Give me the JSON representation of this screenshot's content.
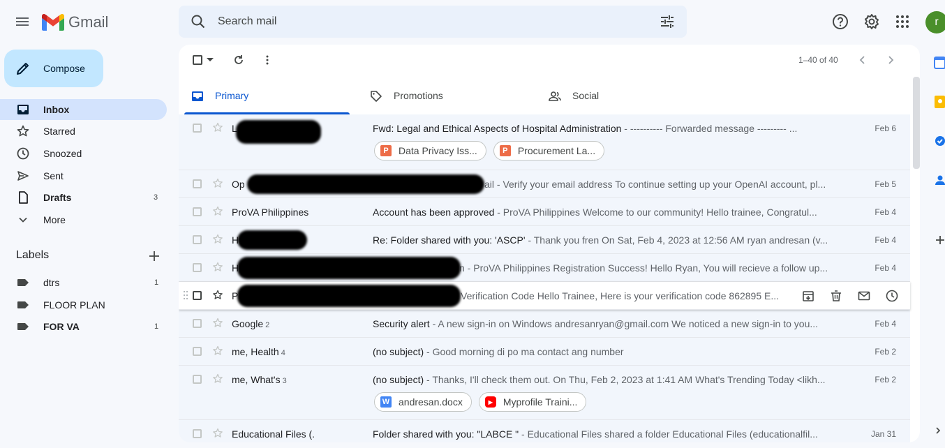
{
  "app": {
    "name": "Gmail"
  },
  "search": {
    "placeholder": "Search mail"
  },
  "avatar": {
    "initial": "r",
    "color": "#4a8f2a"
  },
  "compose": {
    "label": "Compose"
  },
  "nav": [
    {
      "label": "Inbox",
      "count": ""
    },
    {
      "label": "Starred",
      "count": ""
    },
    {
      "label": "Snoozed",
      "count": ""
    },
    {
      "label": "Sent",
      "count": ""
    },
    {
      "label": "Drafts",
      "count": "3"
    },
    {
      "label": "More",
      "count": ""
    }
  ],
  "labels": {
    "heading": "Labels",
    "items": [
      {
        "name": "dtrs",
        "count": "1"
      },
      {
        "name": "FLOOR PLAN",
        "count": ""
      },
      {
        "name": "FOR VA",
        "count": "1"
      }
    ]
  },
  "pager": {
    "text": "1–40 of 40"
  },
  "tabs": [
    {
      "label": "Primary",
      "active": true
    },
    {
      "label": "Promotions",
      "active": false
    },
    {
      "label": "Social",
      "active": false
    }
  ],
  "emails": [
    {
      "sender": "L",
      "count": "",
      "subject": "Fwd: Legal and Ethical Aspects of Hospital Administration",
      "snippet": " - ---------- Forwarded message --------- ...",
      "date": "Feb 6",
      "chips": [
        {
          "name": "Data Privacy Iss...",
          "type": "P",
          "color": "#ed6c47"
        },
        {
          "name": "Procurement La...",
          "type": "P",
          "color": "#ed6c47"
        }
      ]
    },
    {
      "sender": "Op",
      "count": "",
      "subject": "",
      "snippet": "ail - Verify your email address To continue setting up your OpenAI account, pl...",
      "date": "Feb 5",
      "chips": []
    },
    {
      "sender": "ProVA Philippines",
      "count": "",
      "subject": "Account has been approved",
      "snippet": " - ProVA Philippines Welcome to our community! Hello trainee, Congratul...",
      "date": "Feb 4",
      "chips": []
    },
    {
      "sender": "H",
      "count": "",
      "subject": "Re: Folder shared with you: 'ASCP'",
      "snippet": " - Thank you fren On Sat, Feb 4, 2023 at 12:56 AM ryan andresan (v...",
      "date": "Feb 4",
      "chips": []
    },
    {
      "sender": "H",
      "count": "",
      "subject": "",
      "snippet": "n - ProVA Philippines Registration Success! Hello Ryan, You will recieve a follow up...",
      "date": "Feb 4",
      "chips": []
    },
    {
      "sender": "P",
      "count": "",
      "subject": "",
      "snippet": "Verification Code Hello Trainee, Here is your verification code 862895 E...",
      "date": "",
      "chips": []
    },
    {
      "sender": "Google",
      "count": "2",
      "subject": "Security alert",
      "snippet": " - A new sign-in on Windows andresanryan@gmail.com We noticed a new sign-in to you...",
      "date": "Feb 4",
      "chips": []
    },
    {
      "sender": "me, Health",
      "count": "4",
      "subject": "(no subject)",
      "snippet": " - Good morning di po ma contact ang number",
      "date": "Feb 2",
      "chips": []
    },
    {
      "sender": "me, What's",
      "count": "3",
      "subject": "(no subject)",
      "snippet": " - Thanks, I'll check them out. On Thu, Feb 2, 2023 at 1:41 AM What's Trending Today <likh...",
      "date": "Feb 2",
      "chips": [
        {
          "name": "andresan.docx",
          "type": "W",
          "color": "#4285f4"
        },
        {
          "name": "Myprofile Traini...",
          "type": "▶",
          "color": "#ff0000"
        }
      ]
    },
    {
      "sender": "Educational Files (.",
      "count": "",
      "subject": "Folder shared with you: \"LABCE \"",
      "snippet": " - Educational Files shared a folder Educational Files (educationalfil...",
      "date": "Jan 31",
      "chips": []
    }
  ],
  "colors": {
    "accent": "#0b57d0",
    "compose_bg": "#c2e7ff",
    "active_nav": "#d3e3fd"
  }
}
